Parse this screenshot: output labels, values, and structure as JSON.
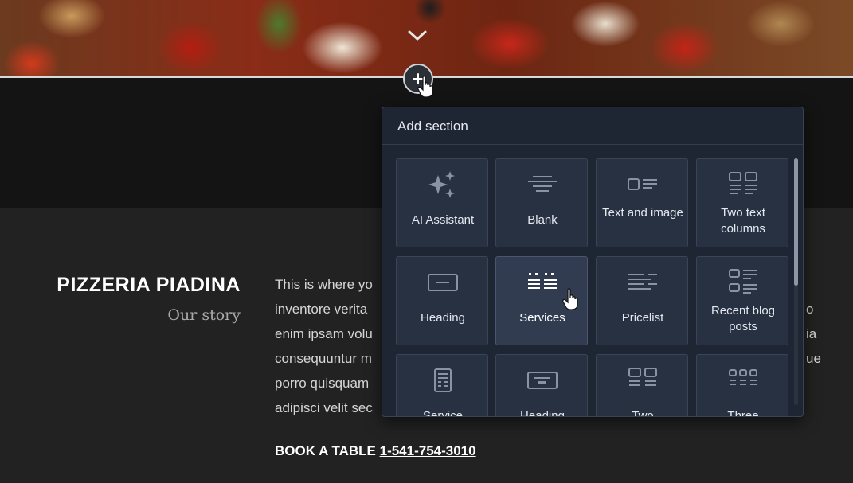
{
  "hero": {
    "chevron_icon": "chevron-down-icon"
  },
  "add_button": {
    "icon": "plus-icon"
  },
  "brand": {
    "title": "PIZZERIA PIADINA",
    "subtitle": "Our story"
  },
  "story": {
    "lines": [
      "This is where yo",
      "inventore verita",
      "enim ipsam volu",
      "consequuntur m",
      "porro quisquam",
      "adipisci velit sec"
    ],
    "right_fragments": [
      "o",
      "ia",
      "ue"
    ]
  },
  "book": {
    "label": "BOOK A TABLE",
    "phone": "1-541-754-3010"
  },
  "panel": {
    "title": "Add section",
    "items": [
      {
        "label": "AI Assistant",
        "icon": "sparkles-icon"
      },
      {
        "label": "Blank",
        "icon": "blank-lines-icon"
      },
      {
        "label": "Text and image",
        "icon": "text-image-icon"
      },
      {
        "label": "Two text columns",
        "icon": "two-columns-icon"
      },
      {
        "label": "Heading",
        "icon": "heading-icon"
      },
      {
        "label": "Services",
        "icon": "services-icon"
      },
      {
        "label": "Pricelist",
        "icon": "pricelist-icon"
      },
      {
        "label": "Recent blog posts",
        "icon": "blog-posts-icon"
      },
      {
        "label": "Service",
        "icon": "document-icon"
      },
      {
        "label": "Heading",
        "icon": "heading-button-icon"
      },
      {
        "label": "Two",
        "icon": "two-cards-icon"
      },
      {
        "label": "Three",
        "icon": "three-cards-icon"
      }
    ]
  },
  "colors": {
    "panel_bg": "#1f2633",
    "card_bg": "#283142",
    "card_active_bg": "#323c50",
    "page_bg": "#222222"
  }
}
